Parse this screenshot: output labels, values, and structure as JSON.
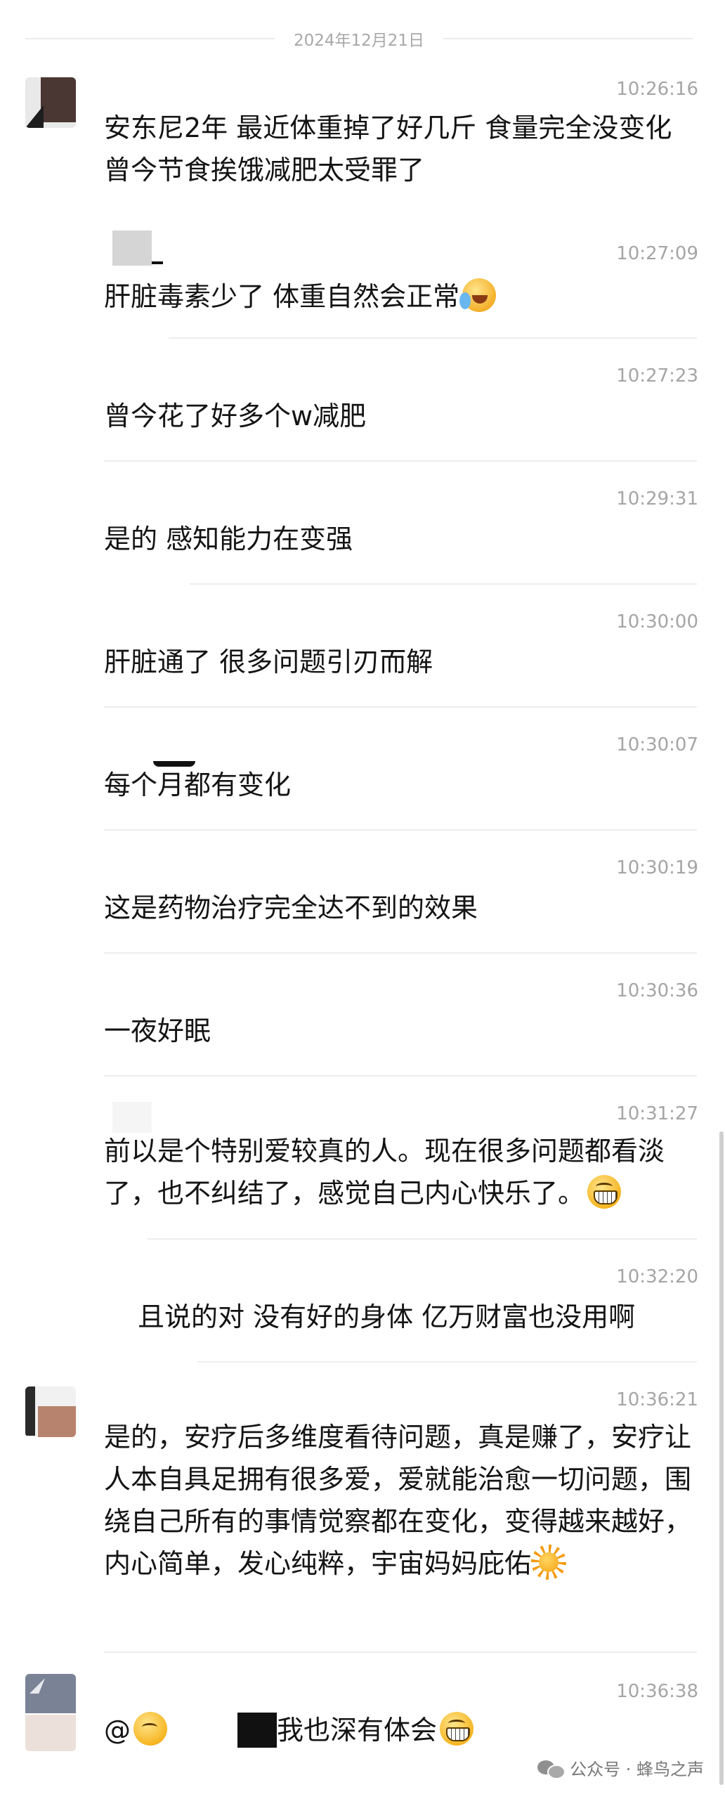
{
  "date_header": "2024年12月21日",
  "messages": [
    {
      "time": "10:26:16",
      "text": "安东尼2年 最近体重掉了好几斤 食量完全没变化 曾今节食挨饿减肥太受罪了"
    },
    {
      "time": "10:27:09",
      "text": "肝脏毒素少了 体重自然会正常",
      "emoji": "crying-laughing-emoji"
    },
    {
      "time": "10:27:23",
      "text": "曾今花了好多个w减肥"
    },
    {
      "time": "10:29:31",
      "text": "是的 感知能力在变强"
    },
    {
      "time": "10:30:00",
      "text": "肝脏通了 很多问题引刃而解"
    },
    {
      "time": "10:30:07",
      "text": "每个月都有变化"
    },
    {
      "time": "10:30:19",
      "text": "这是药物治疗完全达不到的效果"
    },
    {
      "time": "10:30:36",
      "text": "一夜好眠"
    },
    {
      "time": "10:31:27",
      "text": "前以是个特别爱较真的人。现在很多问题都看淡了，也不纠结了，感觉自己内心快乐了。",
      "emoji": "grinning-emoji"
    },
    {
      "time": "10:32:20",
      "text": "且说的对 没有好的身体 亿万财富也没用啊"
    },
    {
      "time": "10:36:21",
      "text": "是的，安疗后多维度看待问题，真是赚了，安疗让人本自具足拥有很多爱，爱就能治愈一切问题，围绕自己所有的事情觉察都在变化，变得越来越好，内心简单，发心纯粹，宇宙妈妈庇佑",
      "emoji": "sun-emoji"
    },
    {
      "time": "10:36:38",
      "text_prefix": "@",
      "text": "我也深有体会",
      "emoji": "grinning-emoji"
    }
  ],
  "watermark": {
    "text": "公众号 · 蜂鸟之声",
    "icon": "wechat-icon"
  }
}
